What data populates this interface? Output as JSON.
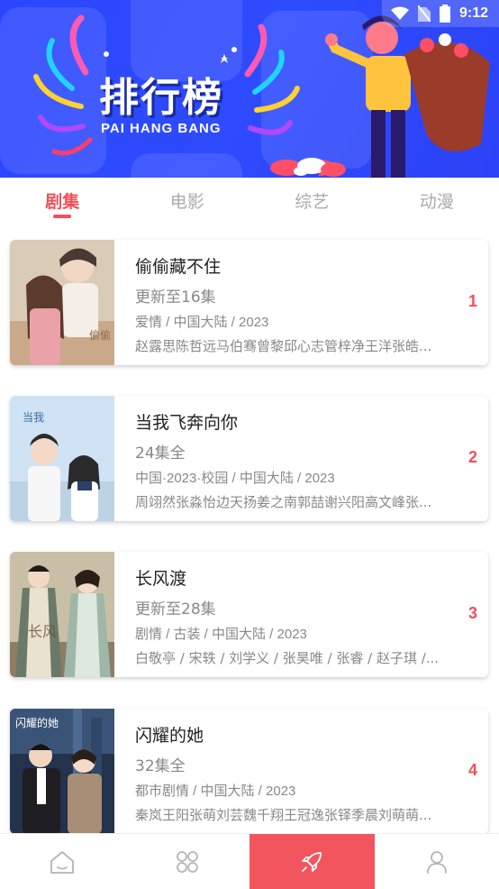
{
  "status_bar": {
    "time": "9:12"
  },
  "banner": {
    "title": "排行榜",
    "subtitle": "PAI HANG BANG"
  },
  "tabs": [
    {
      "label": "剧集",
      "active": true
    },
    {
      "label": "电影",
      "active": false
    },
    {
      "label": "综艺",
      "active": false
    },
    {
      "label": "动漫",
      "active": false
    }
  ],
  "items": [
    {
      "title": "偷偷藏不住",
      "status": "更新至16集",
      "meta": "爱情 / 中国大陆 / 2023",
      "cast": "赵露思陈哲远马伯骞曾黎邱心志管梓净王洋张皓...",
      "rank": "1"
    },
    {
      "title": "当我飞奔向你",
      "status": "24集全",
      "meta": "中国·2023·校园 / 中国大陆 / 2023",
      "cast": "周翊然张淼怡边天扬姜之南郭喆谢兴阳高文峰张...",
      "rank": "2"
    },
    {
      "title": "长风渡",
      "status": "更新至28集",
      "meta": "剧情 / 古装 / 中国大陆 / 2023",
      "cast": "白敬亭 / 宋轶 / 刘学义 / 张昊唯 / 张睿 / 赵子琪 /...",
      "rank": "3"
    },
    {
      "title": "闪耀的她",
      "status": "32集全",
      "meta": "都市剧情 / 中国大陆 / 2023",
      "cast": "秦岚王阳张萌刘芸魏千翔王冠逸张铎季晨刘萌萌...",
      "rank": "4"
    }
  ],
  "bottom_nav": [
    {
      "icon": "home-icon",
      "active": false
    },
    {
      "icon": "grid-icon",
      "active": false
    },
    {
      "icon": "rocket-icon",
      "active": true
    },
    {
      "icon": "user-icon",
      "active": false
    }
  ],
  "colors": {
    "accent": "#f0505a",
    "banner": "#2e4bff",
    "muted": "#888888"
  }
}
